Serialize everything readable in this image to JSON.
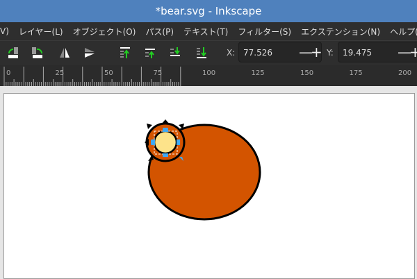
{
  "window": {
    "title": "*bear.svg - Inkscape"
  },
  "menu": [
    "V)",
    "レイヤー(L)",
    "オブジェクト(O)",
    "パス(P)",
    "テキスト(T)",
    "フィルター(S)",
    "エクステンション(N)",
    "ヘルプ(H)"
  ],
  "toolbar": {
    "icons": [
      "rotate-ccw-icon",
      "rotate-cw-icon",
      "flip-horizontal-icon",
      "flip-vertical-icon",
      "raise-to-top-icon",
      "raise-icon",
      "lower-icon",
      "lower-to-bottom-icon"
    ],
    "x_label": "X:",
    "x_value": "77.526",
    "y_label": "Y:",
    "y_value": "19.475",
    "minus": "—",
    "plus": "+"
  },
  "ruler": {
    "ticks": [
      "0",
      "25",
      "50",
      "75",
      "100",
      "125",
      "150",
      "175",
      "200"
    ]
  },
  "colors": {
    "title_bar": "#4f81bd",
    "body_fill": "#d35400",
    "eye_fill": "#fde38a",
    "handle": "#3fa9f5"
  }
}
